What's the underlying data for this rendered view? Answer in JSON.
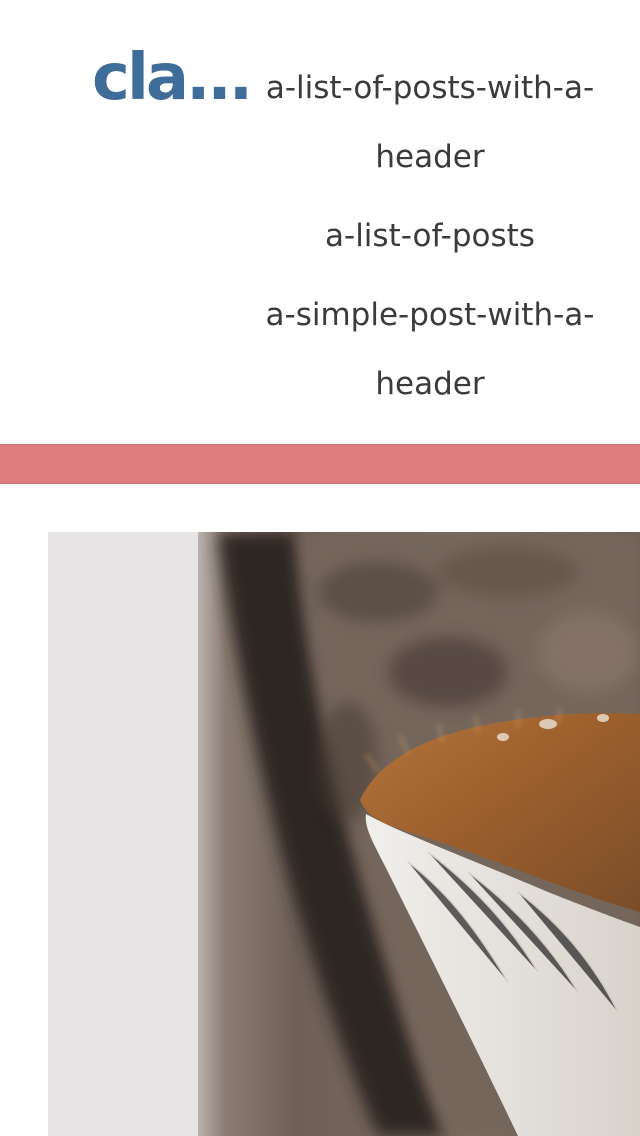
{
  "site": {
    "title": "cla..."
  },
  "nav": {
    "items": [
      {
        "label": "a-list-of-posts-with-a-header"
      },
      {
        "label": "a-list-of-posts"
      },
      {
        "label": "a-simple-post-with-a-header"
      }
    ]
  },
  "colors": {
    "title": "#3e6d99",
    "nav_text": "#3b3b3b",
    "accent_band": "#df7c7e",
    "background": "#ffffff"
  },
  "hero": {
    "subject": "close-up photo of a cat's ear and fur"
  }
}
